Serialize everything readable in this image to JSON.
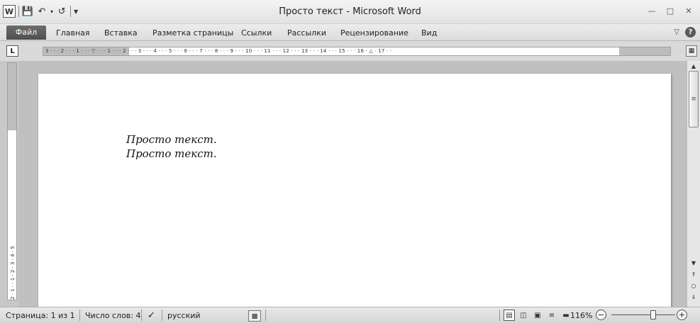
{
  "window": {
    "title": "Просто текст - Microsoft Word",
    "qat_word_icon": "W",
    "controls": [
      "minimize-icon",
      "maximize-icon",
      "close-icon"
    ]
  },
  "ribbon": {
    "tabs": [
      {
        "label": "Файл"
      },
      {
        "label": "Главная"
      },
      {
        "label": "Вставка"
      },
      {
        "label": "Разметка страницы"
      },
      {
        "label": "Ссылки"
      },
      {
        "label": "Рассылки"
      },
      {
        "label": "Рецензирование"
      },
      {
        "label": "Вид"
      }
    ]
  },
  "ruler": {
    "tab_selector": "L",
    "marks": "3 · · · 2 · · · 1 · · · ▽ · · · 1 · · · 2 · · · 3 · · · 4 · · · 5 · · · 6 · · · 7 · · · 8 · · · 9 · · · 10 · · · 11 · · · 12 · · · 13 · · · 14 · · · 15 · · · 16 · △ · 17 · ·",
    "vmarks": "2 · 1 · · 1 · 2 · 3 · 4 · 5"
  },
  "document": {
    "lines": [
      "Просто текст.",
      "Просто текст."
    ]
  },
  "status": {
    "page": "Страница: 1 из 1",
    "words": "Число слов: 4",
    "language": "русский",
    "zoom": "116%",
    "zoom_level": 116
  },
  "colors": {
    "file_tab": "#5a5a5a",
    "page": "#ffffff",
    "workspace": "#c0c0c0"
  }
}
